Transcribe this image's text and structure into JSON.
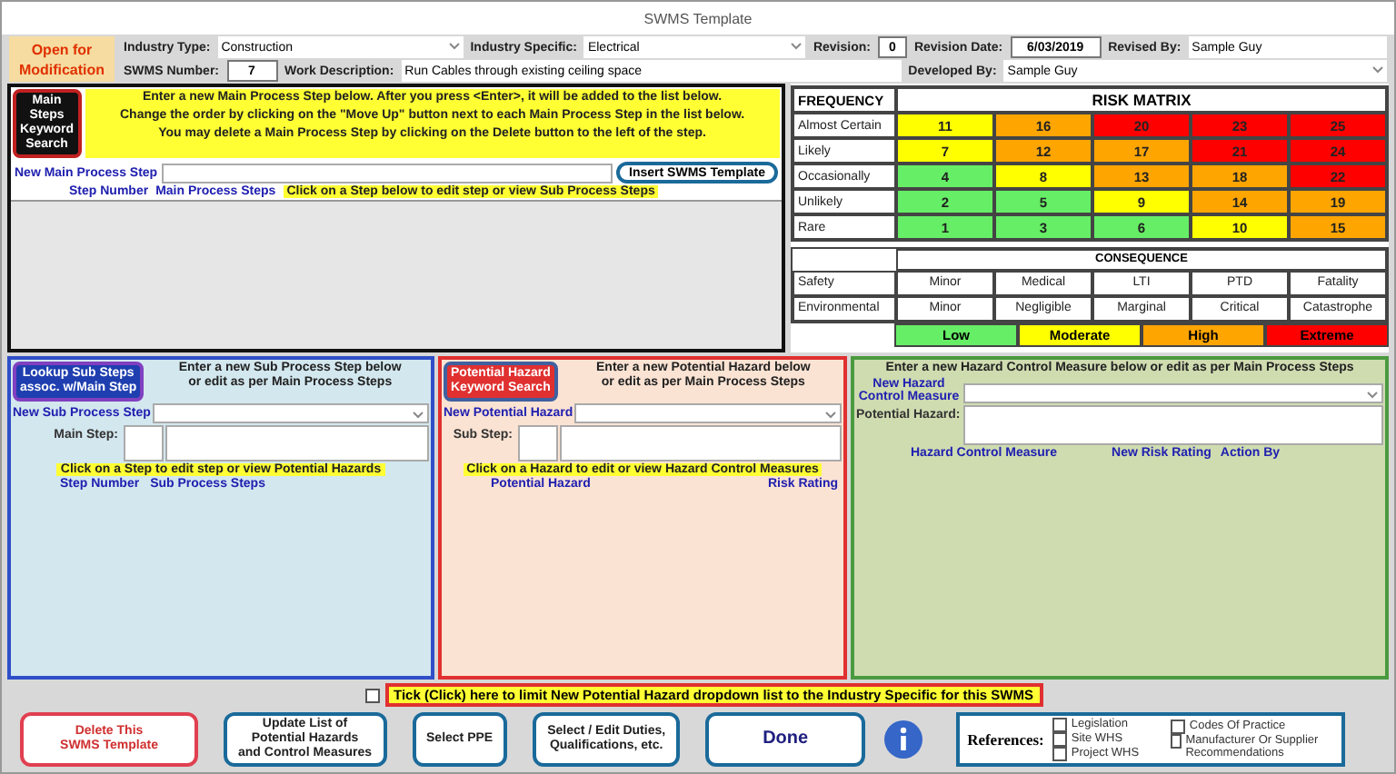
{
  "window": {
    "title": "SWMS Template"
  },
  "status_label": [
    "Open for",
    "Modification"
  ],
  "header": {
    "industry_type": {
      "label": "Industry Type:",
      "value": "Construction"
    },
    "industry_specific": {
      "label": "Industry Specific:",
      "value": "Electrical"
    },
    "revision": {
      "label": "Revision:",
      "value": "0"
    },
    "revision_date": {
      "label": "Revision Date:",
      "value": "6/03/2019"
    },
    "revised_by": {
      "label": "Revised By:",
      "value": "Sample Guy"
    },
    "swms_number": {
      "label": "SWMS Number:",
      "value": "7"
    },
    "work_description": {
      "label": "Work Description:",
      "value": "Run Cables through existing ceiling space"
    },
    "developed_by": {
      "label": "Developed By:",
      "value": "Sample Guy"
    }
  },
  "main_steps": {
    "keyword_button": [
      "Main",
      "Steps",
      "Keyword",
      "Search"
    ],
    "instructions": [
      "Enter a new Main Process Step below.  After you press <Enter>, it will be added to the list below.",
      "Change the order by clicking on the \"Move Up\" button next to each Main Process Step in the list below.",
      "You may delete a Main Process Step by clicking on the Delete button to the left of the step."
    ],
    "new_label": "New Main Process Step",
    "insert_button": "Insert SWMS Template",
    "columns": [
      "Step Number",
      "Main Process Steps"
    ],
    "hint": "Click on a Step below to edit step or view Sub Process Steps"
  },
  "risk_matrix": {
    "frequency_heading": "FREQUENCY",
    "title": "RISK MATRIX",
    "rows": [
      {
        "label": "Almost Certain",
        "cells": [
          {
            "value": "11",
            "color": "#ffff00"
          },
          {
            "value": "16",
            "color": "#ffa500"
          },
          {
            "value": "20",
            "color": "#ff0000"
          },
          {
            "value": "23",
            "color": "#ff0000"
          },
          {
            "value": "25",
            "color": "#ff0000"
          }
        ]
      },
      {
        "label": "Likely",
        "cells": [
          {
            "value": "7",
            "color": "#ffff00"
          },
          {
            "value": "12",
            "color": "#ffa500"
          },
          {
            "value": "17",
            "color": "#ffa500"
          },
          {
            "value": "21",
            "color": "#ff0000"
          },
          {
            "value": "24",
            "color": "#ff0000"
          }
        ]
      },
      {
        "label": "Occasionally",
        "cells": [
          {
            "value": "4",
            "color": "#66ee66"
          },
          {
            "value": "8",
            "color": "#ffff00"
          },
          {
            "value": "13",
            "color": "#ffa500"
          },
          {
            "value": "18",
            "color": "#ffa500"
          },
          {
            "value": "22",
            "color": "#ff0000"
          }
        ]
      },
      {
        "label": "Unlikely",
        "cells": [
          {
            "value": "2",
            "color": "#66ee66"
          },
          {
            "value": "5",
            "color": "#66ee66"
          },
          {
            "value": "9",
            "color": "#ffff00"
          },
          {
            "value": "14",
            "color": "#ffa500"
          },
          {
            "value": "19",
            "color": "#ffa500"
          }
        ]
      },
      {
        "label": "Rare",
        "cells": [
          {
            "value": "1",
            "color": "#66ee66"
          },
          {
            "value": "3",
            "color": "#66ee66"
          },
          {
            "value": "6",
            "color": "#66ee66"
          },
          {
            "value": "10",
            "color": "#ffff00"
          },
          {
            "value": "15",
            "color": "#ffa500"
          }
        ]
      }
    ],
    "consequence_heading": "CONSEQUENCE",
    "consequence_rows": [
      {
        "label": "Safety",
        "values": [
          "Minor",
          "Medical",
          "LTI",
          "PTD",
          "Fatality"
        ]
      },
      {
        "label": "Environmental",
        "values": [
          "Minor",
          "Negligible",
          "Marginal",
          "Critical",
          "Catastrophe"
        ]
      }
    ],
    "legend": [
      {
        "label": "Low",
        "color": "#66ee66"
      },
      {
        "label": "Moderate",
        "color": "#ffff00"
      },
      {
        "label": "High",
        "color": "#ffa500"
      },
      {
        "label": "Extreme",
        "color": "#ff0000"
      }
    ]
  },
  "sub_steps": {
    "button": [
      "Lookup Sub Steps",
      "assoc. w/Main Step"
    ],
    "instructions": [
      "Enter a new Sub Process Step below",
      "or edit as per Main Process Steps"
    ],
    "new_label": "New Sub Process Step",
    "step_label": "Main Step:",
    "hint": "Click on a Step to edit step or view Potential Hazards",
    "columns": [
      "Step Number",
      "Sub Process Steps"
    ]
  },
  "hazards": {
    "button": [
      "Potential Hazard",
      "Keyword Search"
    ],
    "instructions": [
      "Enter a new Potential Hazard below",
      "or edit as per Main Process Steps"
    ],
    "new_label": "New Potential Hazard",
    "step_label": "Sub Step:",
    "hint": "Click on a Hazard to edit or view Hazard Control Measures",
    "columns": [
      "Potential Hazard",
      "Risk Rating"
    ]
  },
  "controls": {
    "instructions": "Enter a new Hazard Control Measure below or edit as per Main Process Steps",
    "new_label": [
      "New Hazard",
      "Control Measure"
    ],
    "hazard_label": "Potential Hazard:",
    "columns": [
      "Hazard Control Measure",
      "New Risk Rating",
      "Action By"
    ]
  },
  "limit_option": {
    "label": "Tick (Click) here to limit New Potential Hazard dropdown list to the Industry Specific for this SWMS",
    "checked": false
  },
  "buttons": [
    {
      "kind": "danger",
      "lines": [
        "Delete This",
        "SWMS Template"
      ]
    },
    {
      "kind": "normal",
      "lines": [
        "Update List of",
        "Potential Hazards",
        "and Control Measures"
      ]
    },
    {
      "kind": "normal",
      "lines": [
        "Select PPE"
      ]
    },
    {
      "kind": "normal",
      "lines": [
        "Select / Edit Duties,",
        "Qualifications, etc."
      ]
    },
    {
      "kind": "primary",
      "lines": [
        "Done"
      ]
    }
  ],
  "references": {
    "label": "References:",
    "columns": [
      [
        {
          "label": "Legislation",
          "checked": false
        },
        {
          "label": "Site WHS",
          "checked": false
        },
        {
          "label": "Project WHS",
          "checked": false
        }
      ],
      [
        {
          "label": "Codes Of Practice",
          "checked": false
        },
        {
          "label": "Manufacturer Or Supplier Recommendations",
          "checked": false
        }
      ]
    ]
  }
}
